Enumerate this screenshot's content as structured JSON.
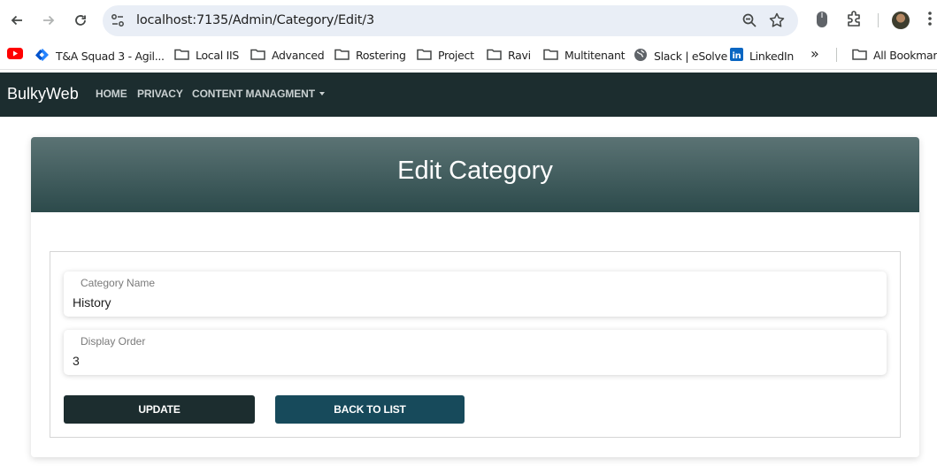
{
  "browser": {
    "url": "localhost:7135/Admin/Category/Edit/3",
    "bookmarks": [
      {
        "label": "",
        "icon": "youtube-icon"
      },
      {
        "label": "T&A Squad 3 - Agil...",
        "icon": "jira-icon"
      },
      {
        "label": "Local IIS",
        "icon": "folder-icon"
      },
      {
        "label": "Advanced",
        "icon": "folder-icon"
      },
      {
        "label": "Rostering",
        "icon": "folder-icon"
      },
      {
        "label": "Project",
        "icon": "folder-icon"
      },
      {
        "label": "Ravi",
        "icon": "folder-icon"
      },
      {
        "label": "Multitenant",
        "icon": "folder-icon"
      },
      {
        "label": "Slack | eSolve",
        "icon": "globe-icon"
      },
      {
        "label": "LinkedIn",
        "icon": "linkedin-icon"
      }
    ],
    "overflow_label": "»",
    "all_bookmarks": "All Bookmarks"
  },
  "navbar": {
    "brand": "BulkyWeb",
    "links": [
      "HOME",
      "PRIVACY",
      "CONTENT MANAGMENT"
    ],
    "colors": {
      "background": "#1c2d2f"
    }
  },
  "card": {
    "title": "Edit Category",
    "fields": [
      {
        "label": "Category Name",
        "value": "History"
      },
      {
        "label": "Display Order",
        "value": "3"
      }
    ],
    "update_label": "UPDATE",
    "back_label": "BACK TO LIST",
    "colors": {
      "header_top": "#5b7374",
      "header_bottom": "#2c4a4b",
      "update": "#1c2d2f",
      "back": "#174a5b"
    }
  }
}
